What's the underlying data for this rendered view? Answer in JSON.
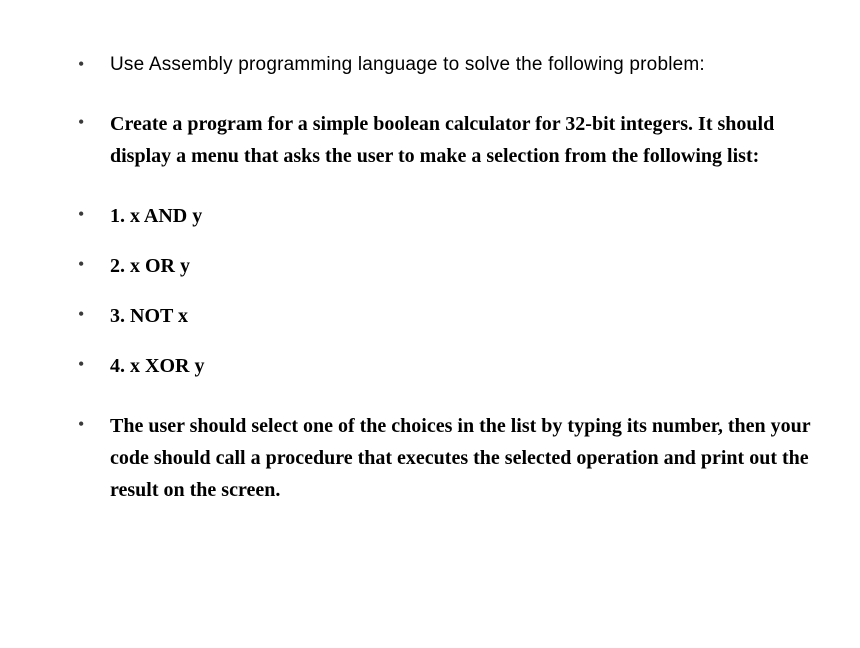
{
  "items": [
    {
      "text": "Use Assembly programming language to solve the following problem:",
      "style": "normal"
    },
    {
      "text": "Create a program for a simple boolean calculator for 32-bit integers. It should display a menu that asks the user to make a selection from the following list:",
      "style": "bold"
    },
    {
      "text": "1. x AND y",
      "style": "bold"
    },
    {
      "text": "2. x OR y",
      "style": "bold"
    },
    {
      "text": "3. NOT x",
      "style": "bold"
    },
    {
      "text": "4. x XOR y",
      "style": "bold"
    },
    {
      "text": "The user should select one of the choices in the list by typing its number, then your code should call a procedure that executes the selected operation and print out the result on the screen.",
      "style": "bold"
    }
  ]
}
